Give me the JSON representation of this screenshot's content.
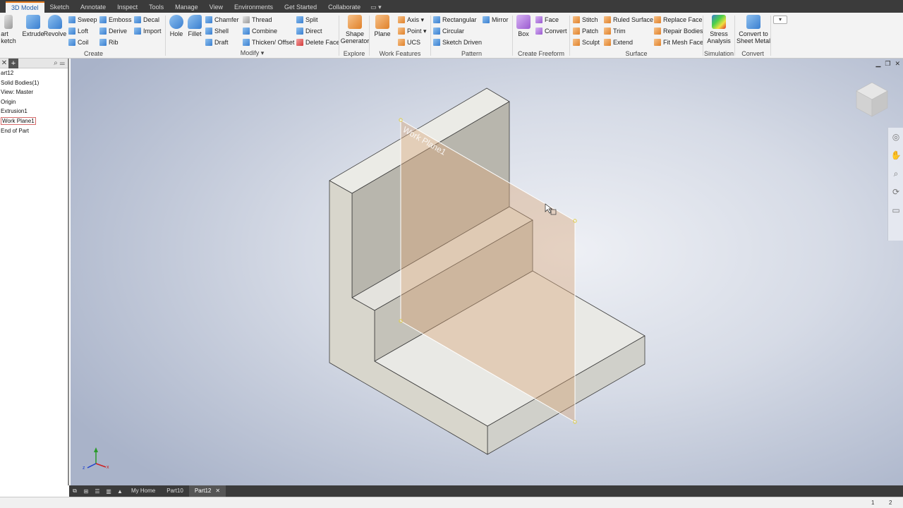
{
  "ribbon_tabs": [
    "3D Model",
    "Sketch",
    "Annotate",
    "Inspect",
    "Tools",
    "Manage",
    "View",
    "Environments",
    "Get Started",
    "Collaborate"
  ],
  "ribbon_tab_extra": "▭ ▾",
  "panels": {
    "create": {
      "label": "Create",
      "start_sketch": "art\nketch",
      "extrude": "Extrude",
      "revolve": "Revolve",
      "sweep": "Sweep",
      "loft": "Loft",
      "coil": "Coil",
      "emboss": "Emboss",
      "derive": "Derive",
      "rib": "Rib",
      "decal": "Decal",
      "import": "Import"
    },
    "modify": {
      "label": "Modify ▾",
      "hole": "Hole",
      "fillet": "Fillet",
      "chamfer": "Chamfer",
      "shell": "Shell",
      "draft": "Draft",
      "thread": "Thread",
      "combine": "Combine",
      "thicken": "Thicken/ Offset",
      "split": "Split",
      "direct": "Direct",
      "delete_face": "Delete Face"
    },
    "explore": {
      "label": "Explore",
      "shape_gen": "Shape\nGenerator"
    },
    "work": {
      "label": "Work Features",
      "plane": "Plane",
      "axis": "Axis ▾",
      "point": "Point ▾",
      "ucs": "UCS"
    },
    "pattern": {
      "label": "Pattern",
      "rectangular": "Rectangular",
      "circular": "Circular",
      "sketch_driven": "Sketch Driven",
      "mirror": "Mirror"
    },
    "freeform": {
      "label": "Create Freeform",
      "box": "Box",
      "face": "Face",
      "convert": "Convert"
    },
    "surface": {
      "label": "Surface",
      "stitch": "Stitch",
      "patch": "Patch",
      "sculpt": "Sculpt",
      "ruled": "Ruled Surface",
      "trim": "Trim",
      "extend": "Extend",
      "replace": "Replace Face",
      "repair": "Repair Bodies",
      "fitmesh": "Fit Mesh Face"
    },
    "simulation": {
      "label": "Simulation",
      "stress": "Stress\nAnalysis"
    },
    "convert": {
      "label": "Convert",
      "sheetmetal": "Convert to\nSheet Metal"
    }
  },
  "browser": {
    "items": [
      "art12",
      "Solid Bodies(1)",
      "View: Master",
      "Origin",
      "Extrusion1",
      "Work Plane1",
      "End of Part"
    ],
    "selected_index": 5
  },
  "viewport": {
    "work_plane_label": "Work Plane1"
  },
  "doc_tabs": [
    "My Home",
    "Part10",
    "Part12"
  ],
  "doc_tab_close": "✕",
  "status": {
    "page1": "1",
    "page2": "2"
  },
  "colors": {
    "accent_tab": "#1d5aa8",
    "tab_underline": "#e57b1f",
    "work_plane": "#d9a67a",
    "model_face": "#d8d6cc"
  }
}
